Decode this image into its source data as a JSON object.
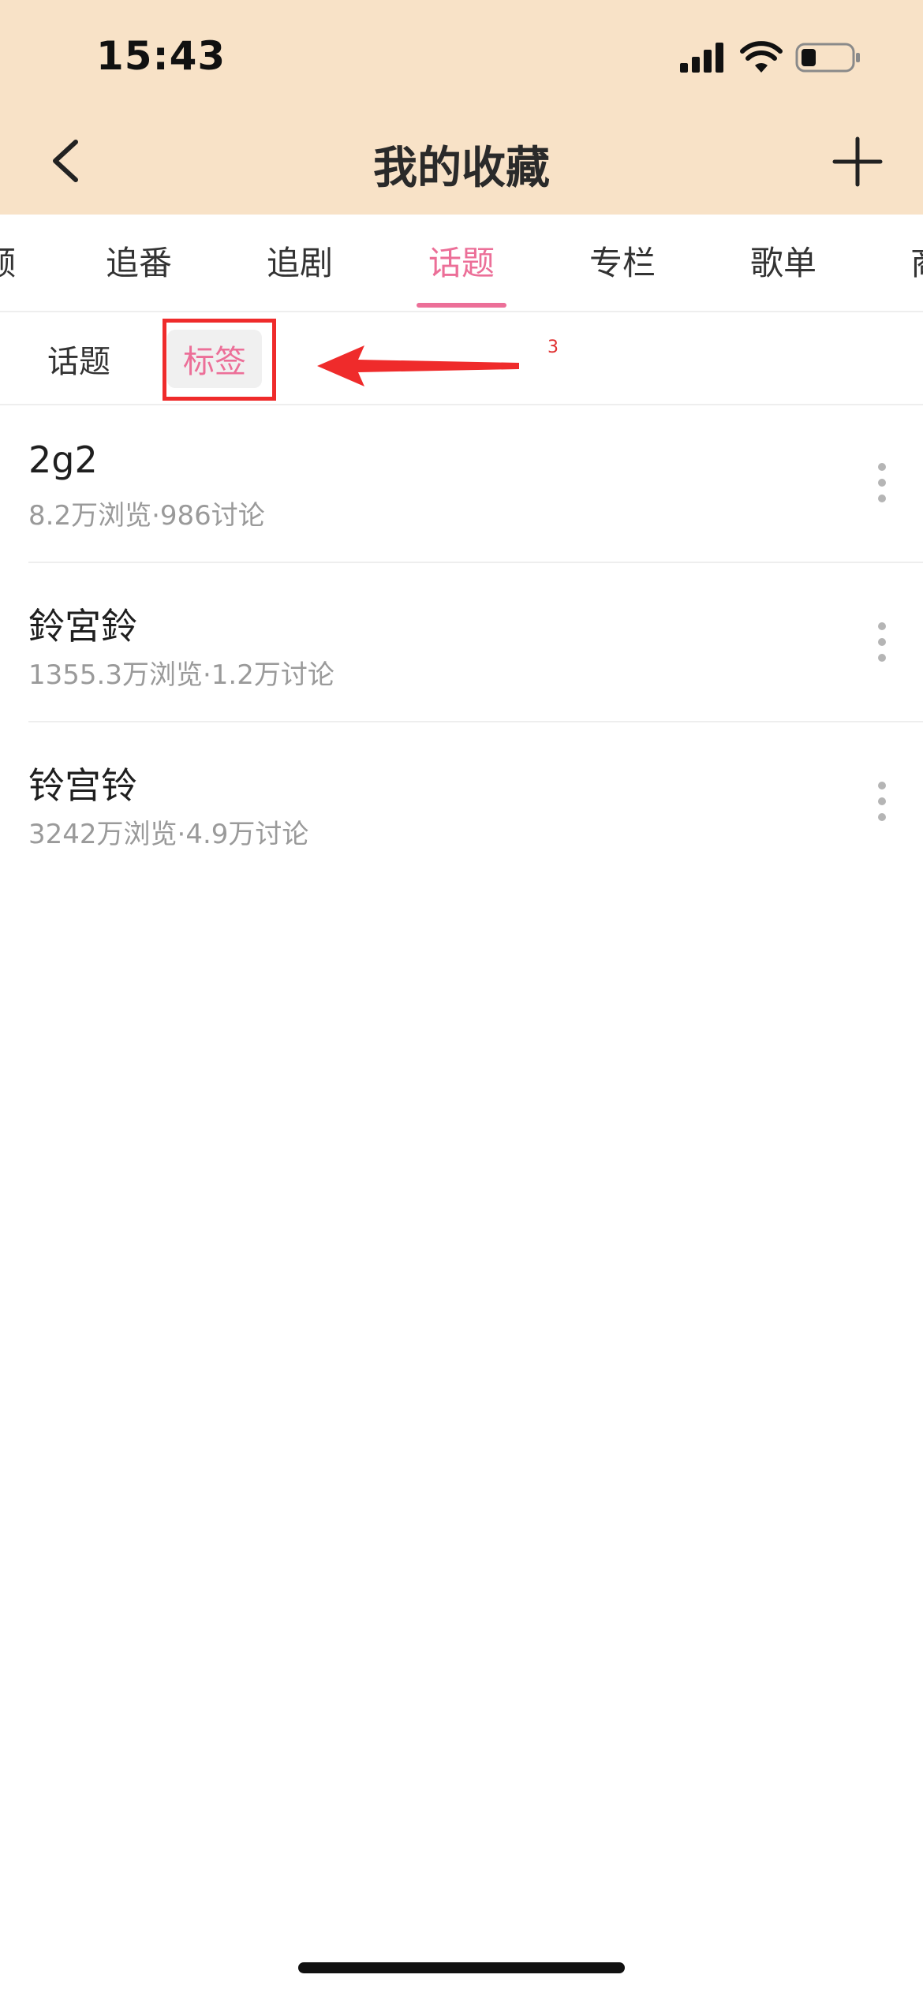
{
  "status_bar": {
    "time": "15:43"
  },
  "nav": {
    "title": "我的收藏",
    "back_icon": "chevron-left-icon",
    "add_icon": "plus-icon"
  },
  "tabs": [
    {
      "label": "频",
      "active": false
    },
    {
      "label": "追番",
      "active": false
    },
    {
      "label": "追剧",
      "active": false
    },
    {
      "label": "话题",
      "active": true
    },
    {
      "label": "专栏",
      "active": false
    },
    {
      "label": "歌单",
      "active": false
    },
    {
      "label": "商",
      "active": false
    }
  ],
  "subtabs": [
    {
      "label": "话题",
      "active": false
    },
    {
      "label": "标签",
      "active": true
    }
  ],
  "annotation": {
    "number": "3"
  },
  "items": [
    {
      "title": "2g2",
      "meta": "8.2万浏览·986讨论"
    },
    {
      "title": "鈴宮鈴",
      "meta": "1355.3万浏览·1.2万讨论"
    },
    {
      "title": "铃宫铃",
      "meta": "3242万浏览·4.9万讨论"
    }
  ],
  "colors": {
    "header_bg": "#f8e2c7",
    "accent": "#ec6f98",
    "annotation": "#ef2b2b"
  }
}
